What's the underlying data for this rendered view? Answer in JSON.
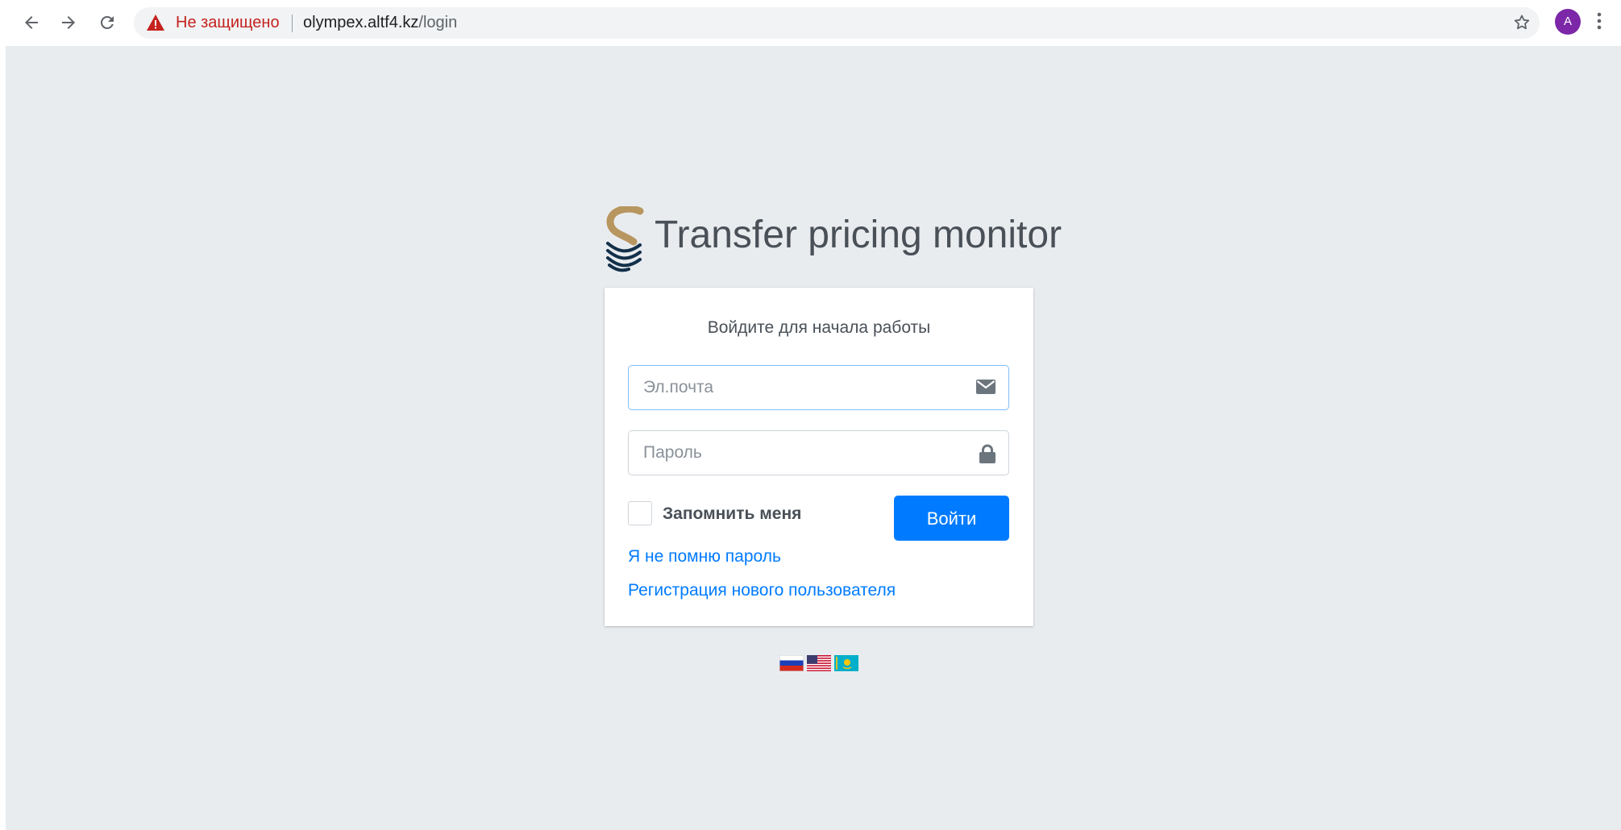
{
  "browser": {
    "security_label": "Не защищено",
    "url_host": "olympex.altf4.kz",
    "url_path": "/login",
    "profile_initial": "A"
  },
  "logo": {
    "title": "Transfer pricing monitor"
  },
  "login": {
    "message": "Войдите для начала работы",
    "email_placeholder": "Эл.почта",
    "email_value": "",
    "password_placeholder": "Пароль",
    "password_value": "",
    "remember_label": "Запомнить меня",
    "remember_checked": false,
    "submit_label": "Войти",
    "forgot_link": "Я не помню пароль",
    "register_link": "Регистрация нового пользователя"
  },
  "languages": [
    {
      "name": "ru-flag-icon"
    },
    {
      "name": "us-flag-icon"
    },
    {
      "name": "kz-flag-icon"
    }
  ],
  "colors": {
    "primary": "#007bff",
    "page_bg": "#e9ecef",
    "warning": "#c5221f",
    "logo_gold": "#b89660",
    "logo_navy": "#13304a"
  }
}
